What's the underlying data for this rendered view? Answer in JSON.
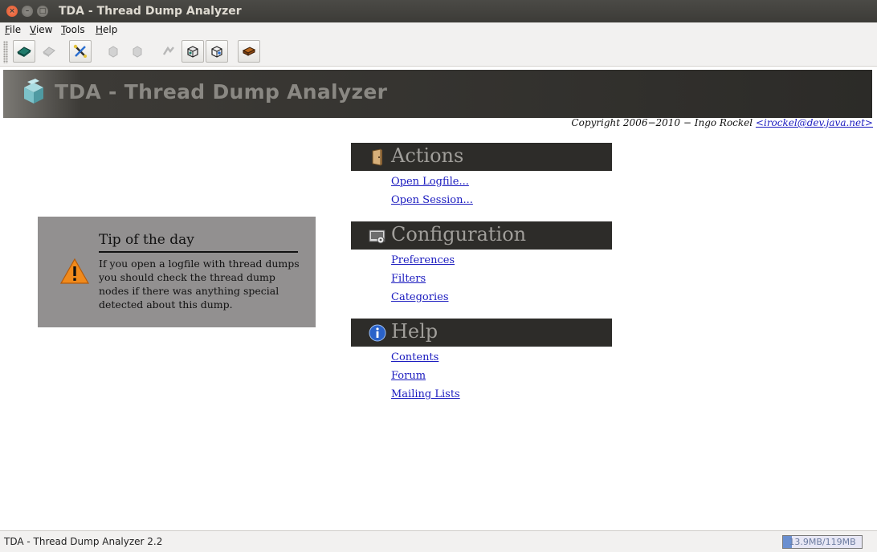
{
  "window": {
    "title": "TDA - Thread Dump Analyzer"
  },
  "menu": [
    {
      "first": "F",
      "rest": "ile"
    },
    {
      "first": "V",
      "rest": "iew"
    },
    {
      "first": "T",
      "rest": "ools"
    },
    {
      "first": "H",
      "rest": "elp"
    }
  ],
  "toolbar": {
    "buttons": [
      {
        "icon": "open-book-icon",
        "enabled": true
      },
      {
        "icon": "close-file-icon",
        "enabled": false
      },
      {
        "icon": "preferences-tools-icon",
        "enabled": true
      },
      {
        "icon": "expand-all-icon",
        "enabled": false
      },
      {
        "icon": "collapse-all-icon",
        "enabled": false
      },
      {
        "icon": "find-long-running-icon",
        "enabled": false
      },
      {
        "icon": "monitor-dump-icon",
        "enabled": true
      },
      {
        "icon": "session-dump-icon",
        "enabled": true
      },
      {
        "icon": "help-book-icon",
        "enabled": true
      }
    ]
  },
  "banner": {
    "title": "TDA - Thread Dump Analyzer"
  },
  "copyright": {
    "text": "Copyright 2006−2010 − Ingo Rockel ",
    "email": "<irockel@dev.java.net>"
  },
  "tip": {
    "heading": "Tip of the day",
    "body": "If you open a logfile with thread dumps you should check the thread dump nodes if there was anything special detected about this dump.",
    "icon": "warning-icon"
  },
  "sections": {
    "actions": {
      "title": "Actions",
      "icon": "door-icon",
      "links": [
        "Open Logfile...",
        "Open Session..."
      ]
    },
    "configuration": {
      "title": "Configuration",
      "icon": "configuration-icon",
      "links": [
        "Preferences",
        "Filters",
        "Categories"
      ]
    },
    "help": {
      "title": "Help",
      "icon": "info-icon",
      "links": [
        "Contents",
        "Forum",
        "Mailing Lists"
      ]
    }
  },
  "status": {
    "text": "TDA - Thread Dump Analyzer 2.2",
    "memory": "13.9MB/119MB",
    "memory_used_fraction": 0.117
  },
  "colors": {
    "banner": "#2c2b28",
    "tip_bg": "#929090",
    "link": "#1b1bbf"
  }
}
